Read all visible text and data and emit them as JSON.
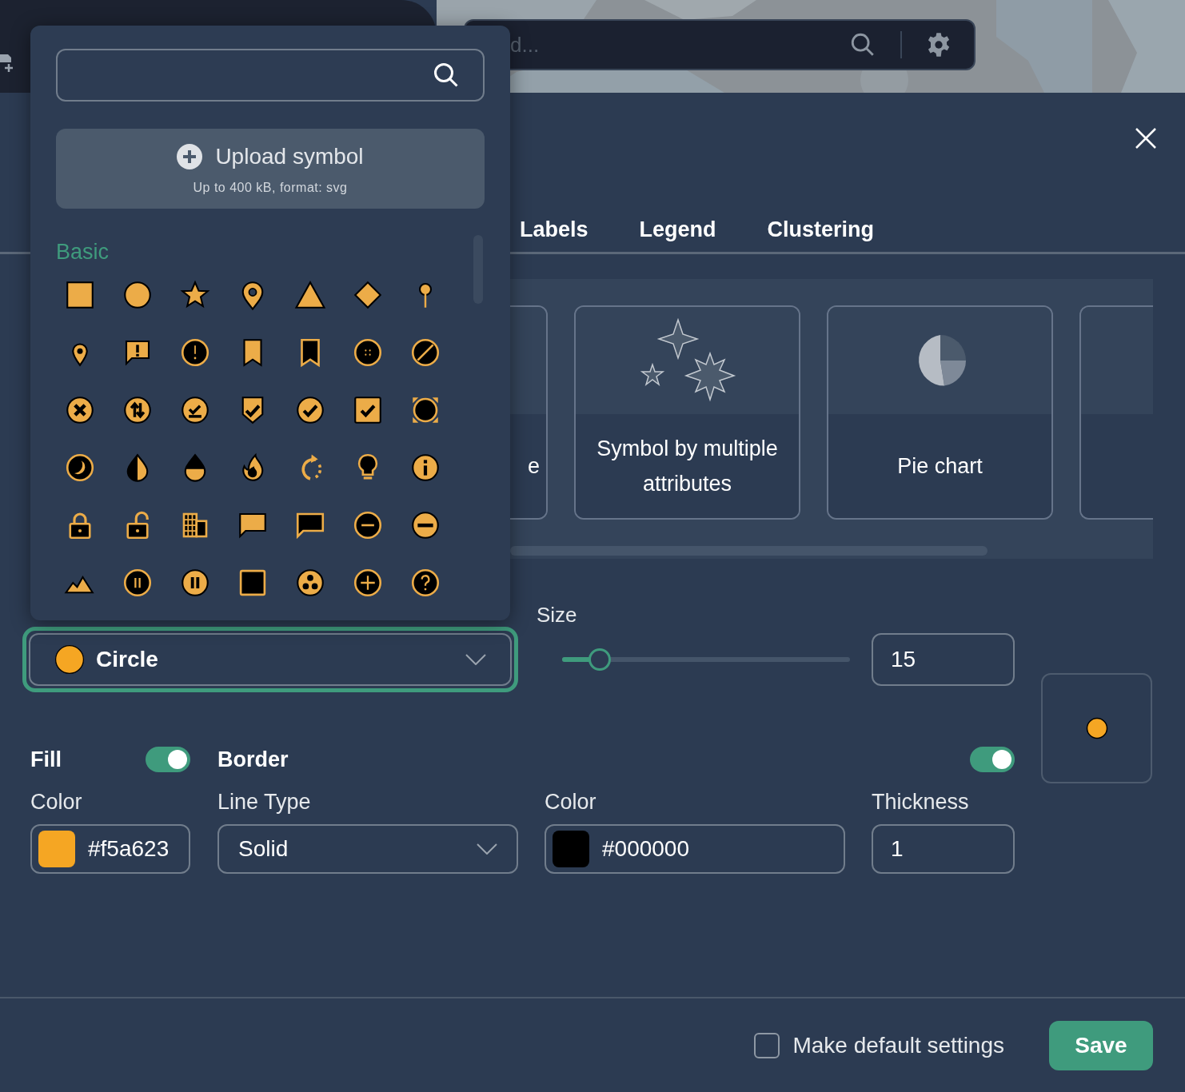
{
  "map_header": {
    "search": {
      "placeholder": "d..."
    }
  },
  "symbol_picker": {
    "upload": {
      "label": "Upload symbol",
      "hint": "Up to 400 kB, format: svg"
    },
    "category": "Basic"
  },
  "dialog": {
    "tabs": [
      {
        "label": "Labels",
        "selected": false
      },
      {
        "label": "Legend",
        "selected": false
      },
      {
        "label": "Clustering",
        "selected": false
      }
    ],
    "styles": [
      {
        "kind": "partial",
        "label": "e"
      },
      {
        "kind": "multiple",
        "label": "Symbol by multiple attributes"
      },
      {
        "kind": "pie",
        "label": "Pie chart"
      },
      {
        "kind": "edge"
      }
    ],
    "symbol_select": {
      "value": "Circle",
      "focused": true
    },
    "size": {
      "label": "Size",
      "level": 0.1,
      "value": "15"
    },
    "fill": {
      "label": "Fill",
      "on": true,
      "color_label": "Color",
      "value": "#f5a623"
    },
    "border": {
      "label": "Border",
      "on": true,
      "line_type_label": "Line Type",
      "line_type": "Solid",
      "color_label": "Color",
      "color_value": "#000000",
      "thickness_label": "Thickness",
      "thickness": "1"
    },
    "default_settings": {
      "label": "Make default settings",
      "checked": false
    },
    "save": "Save"
  }
}
